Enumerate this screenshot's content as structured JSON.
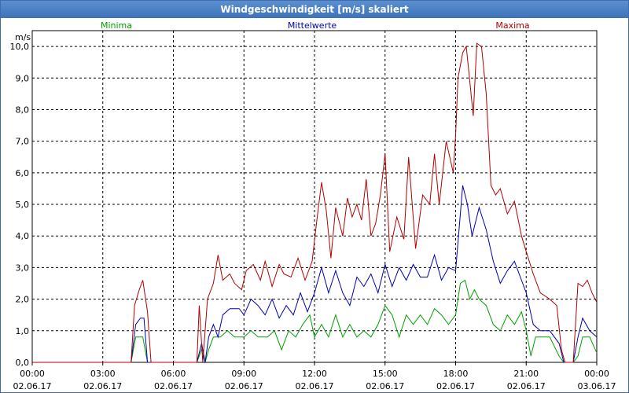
{
  "window": {
    "title": "Windgeschwindigkeit [m/s] skaliert"
  },
  "chart_data": {
    "type": "line",
    "title": "Windgeschwindigkeit [m/s] skaliert",
    "ylabel": "m/s",
    "ylim": [
      0,
      10.5
    ],
    "xlim": [
      0,
      24
    ],
    "yticks": [
      "0,0",
      "1,0",
      "2,0",
      "3,0",
      "4,0",
      "5,0",
      "6,0",
      "7,0",
      "8,0",
      "9,0",
      "10,0"
    ],
    "xticks": [
      {
        "t": "00:00",
        "d": "02.06.17"
      },
      {
        "t": "03:00",
        "d": "02.06.17"
      },
      {
        "t": "06:00",
        "d": "02.06.17"
      },
      {
        "t": "09:00",
        "d": "02.06.17"
      },
      {
        "t": "12:00",
        "d": "02.06.17"
      },
      {
        "t": "15:00",
        "d": "02.06.17"
      },
      {
        "t": "18:00",
        "d": "02.06.17"
      },
      {
        "t": "21:00",
        "d": "02.06.17"
      },
      {
        "t": "00:00",
        "d": "03.06.17"
      }
    ],
    "grid": true,
    "legend_position": "top",
    "series": [
      {
        "name": "Minima",
        "color": "#00a000",
        "points": [
          [
            0,
            0
          ],
          [
            4.2,
            0
          ],
          [
            4.4,
            0.8
          ],
          [
            4.7,
            0.8
          ],
          [
            4.9,
            0
          ],
          [
            7.0,
            0
          ],
          [
            7.2,
            0.4
          ],
          [
            7.35,
            0
          ],
          [
            7.5,
            0.4
          ],
          [
            7.7,
            0.8
          ],
          [
            8.0,
            0.8
          ],
          [
            8.3,
            1.0
          ],
          [
            8.6,
            0.8
          ],
          [
            9.0,
            0.8
          ],
          [
            9.3,
            1.0
          ],
          [
            9.6,
            0.8
          ],
          [
            10.0,
            0.8
          ],
          [
            10.3,
            1.0
          ],
          [
            10.6,
            0.4
          ],
          [
            10.9,
            1.0
          ],
          [
            11.2,
            0.8
          ],
          [
            11.5,
            1.2
          ],
          [
            11.8,
            1.5
          ],
          [
            12.0,
            0.8
          ],
          [
            12.3,
            1.2
          ],
          [
            12.6,
            0.8
          ],
          [
            12.9,
            1.5
          ],
          [
            13.2,
            0.8
          ],
          [
            13.5,
            1.2
          ],
          [
            13.8,
            0.8
          ],
          [
            14.1,
            1.0
          ],
          [
            14.4,
            0.8
          ],
          [
            14.7,
            1.2
          ],
          [
            15.0,
            1.8
          ],
          [
            15.3,
            1.5
          ],
          [
            15.6,
            0.8
          ],
          [
            15.9,
            1.5
          ],
          [
            16.2,
            1.2
          ],
          [
            16.5,
            1.5
          ],
          [
            16.8,
            1.2
          ],
          [
            17.1,
            1.7
          ],
          [
            17.4,
            1.5
          ],
          [
            17.7,
            1.2
          ],
          [
            18.0,
            1.5
          ],
          [
            18.2,
            2.5
          ],
          [
            18.4,
            2.6
          ],
          [
            18.6,
            2.0
          ],
          [
            18.8,
            2.3
          ],
          [
            19.0,
            2.0
          ],
          [
            19.3,
            1.8
          ],
          [
            19.6,
            1.2
          ],
          [
            19.9,
            1.0
          ],
          [
            20.2,
            1.5
          ],
          [
            20.5,
            1.2
          ],
          [
            20.8,
            1.6
          ],
          [
            21.0,
            1.0
          ],
          [
            21.2,
            0.2
          ],
          [
            21.4,
            0.8
          ],
          [
            22.0,
            0.8
          ],
          [
            22.4,
            0.2
          ],
          [
            22.6,
            0
          ],
          [
            23.0,
            0
          ],
          [
            23.2,
            0.2
          ],
          [
            23.4,
            0.8
          ],
          [
            23.7,
            0.8
          ],
          [
            24.0,
            0.3
          ]
        ]
      },
      {
        "name": "Mittelwerte",
        "color": "#0000b0",
        "points": [
          [
            0,
            0
          ],
          [
            4.2,
            0
          ],
          [
            4.4,
            1.2
          ],
          [
            4.6,
            1.4
          ],
          [
            4.75,
            1.4
          ],
          [
            4.9,
            0
          ],
          [
            7.0,
            0
          ],
          [
            7.2,
            0.6
          ],
          [
            7.35,
            0
          ],
          [
            7.5,
            0.8
          ],
          [
            7.7,
            1.2
          ],
          [
            7.9,
            0.8
          ],
          [
            8.1,
            1.5
          ],
          [
            8.4,
            1.7
          ],
          [
            8.8,
            1.7
          ],
          [
            9.0,
            1.5
          ],
          [
            9.3,
            2.0
          ],
          [
            9.6,
            1.8
          ],
          [
            9.9,
            1.5
          ],
          [
            10.2,
            2.0
          ],
          [
            10.5,
            1.4
          ],
          [
            10.8,
            1.8
          ],
          [
            11.1,
            1.5
          ],
          [
            11.4,
            2.2
          ],
          [
            11.7,
            1.6
          ],
          [
            12.0,
            2.2
          ],
          [
            12.3,
            3.0
          ],
          [
            12.6,
            2.2
          ],
          [
            12.9,
            2.9
          ],
          [
            13.2,
            2.2
          ],
          [
            13.5,
            1.8
          ],
          [
            13.8,
            2.7
          ],
          [
            14.1,
            2.4
          ],
          [
            14.4,
            2.8
          ],
          [
            14.7,
            2.2
          ],
          [
            15.0,
            3.1
          ],
          [
            15.3,
            2.4
          ],
          [
            15.6,
            3.0
          ],
          [
            15.9,
            2.6
          ],
          [
            16.2,
            3.1
          ],
          [
            16.5,
            2.7
          ],
          [
            16.8,
            2.7
          ],
          [
            17.1,
            3.4
          ],
          [
            17.4,
            2.6
          ],
          [
            17.7,
            3.0
          ],
          [
            18.0,
            2.9
          ],
          [
            18.3,
            5.6
          ],
          [
            18.5,
            5.0
          ],
          [
            18.7,
            4.0
          ],
          [
            19.0,
            4.9
          ],
          [
            19.3,
            4.2
          ],
          [
            19.6,
            3.2
          ],
          [
            19.9,
            2.5
          ],
          [
            20.2,
            2.9
          ],
          [
            20.5,
            3.2
          ],
          [
            20.8,
            2.6
          ],
          [
            21.0,
            2.2
          ],
          [
            21.3,
            1.2
          ],
          [
            21.6,
            1.0
          ],
          [
            22.0,
            1.0
          ],
          [
            22.4,
            0.6
          ],
          [
            22.6,
            0
          ],
          [
            23.0,
            0
          ],
          [
            23.2,
            0.8
          ],
          [
            23.4,
            1.4
          ],
          [
            23.7,
            1.0
          ],
          [
            24.0,
            0.8
          ]
        ]
      },
      {
        "name": "Maxima",
        "color": "#b00000",
        "points": [
          [
            0,
            0
          ],
          [
            4.2,
            0
          ],
          [
            4.35,
            1.8
          ],
          [
            4.55,
            2.3
          ],
          [
            4.7,
            2.6
          ],
          [
            4.9,
            1.6
          ],
          [
            5.05,
            0
          ],
          [
            7.0,
            0
          ],
          [
            7.1,
            1.8
          ],
          [
            7.25,
            0
          ],
          [
            7.45,
            2.0
          ],
          [
            7.7,
            2.5
          ],
          [
            7.9,
            3.4
          ],
          [
            8.1,
            2.6
          ],
          [
            8.4,
            2.8
          ],
          [
            8.6,
            2.5
          ],
          [
            8.9,
            2.3
          ],
          [
            9.1,
            2.9
          ],
          [
            9.4,
            3.1
          ],
          [
            9.7,
            2.6
          ],
          [
            9.9,
            3.2
          ],
          [
            10.2,
            2.4
          ],
          [
            10.5,
            3.1
          ],
          [
            10.7,
            2.8
          ],
          [
            11.0,
            2.7
          ],
          [
            11.3,
            3.3
          ],
          [
            11.6,
            2.6
          ],
          [
            11.9,
            3.2
          ],
          [
            12.1,
            4.5
          ],
          [
            12.3,
            5.7
          ],
          [
            12.5,
            4.8
          ],
          [
            12.7,
            3.3
          ],
          [
            12.9,
            4.9
          ],
          [
            13.2,
            4.0
          ],
          [
            13.4,
            5.2
          ],
          [
            13.6,
            4.6
          ],
          [
            13.8,
            5.0
          ],
          [
            14.0,
            4.5
          ],
          [
            14.2,
            5.8
          ],
          [
            14.4,
            4.0
          ],
          [
            14.6,
            4.4
          ],
          [
            14.8,
            5.3
          ],
          [
            15.0,
            6.6
          ],
          [
            15.2,
            3.5
          ],
          [
            15.5,
            4.6
          ],
          [
            15.8,
            3.9
          ],
          [
            16.0,
            6.5
          ],
          [
            16.3,
            3.6
          ],
          [
            16.6,
            5.3
          ],
          [
            16.9,
            5.0
          ],
          [
            17.1,
            6.6
          ],
          [
            17.3,
            5.0
          ],
          [
            17.6,
            7.0
          ],
          [
            17.9,
            6.0
          ],
          [
            18.0,
            7.2
          ],
          [
            18.1,
            9.0
          ],
          [
            18.3,
            9.8
          ],
          [
            18.45,
            10.0
          ],
          [
            18.6,
            8.9
          ],
          [
            18.75,
            7.8
          ],
          [
            18.9,
            10.1
          ],
          [
            19.1,
            10.0
          ],
          [
            19.3,
            8.5
          ],
          [
            19.5,
            5.6
          ],
          [
            19.7,
            5.3
          ],
          [
            19.9,
            5.5
          ],
          [
            20.2,
            4.7
          ],
          [
            20.5,
            5.1
          ],
          [
            20.8,
            4.0
          ],
          [
            21.0,
            3.5
          ],
          [
            21.3,
            2.8
          ],
          [
            21.6,
            2.2
          ],
          [
            22.0,
            2.0
          ],
          [
            22.3,
            1.8
          ],
          [
            22.5,
            0.4
          ],
          [
            22.65,
            0
          ],
          [
            23.0,
            0
          ],
          [
            23.2,
            2.5
          ],
          [
            23.4,
            2.4
          ],
          [
            23.6,
            2.6
          ],
          [
            23.8,
            2.2
          ],
          [
            24.0,
            1.9
          ]
        ]
      }
    ]
  }
}
